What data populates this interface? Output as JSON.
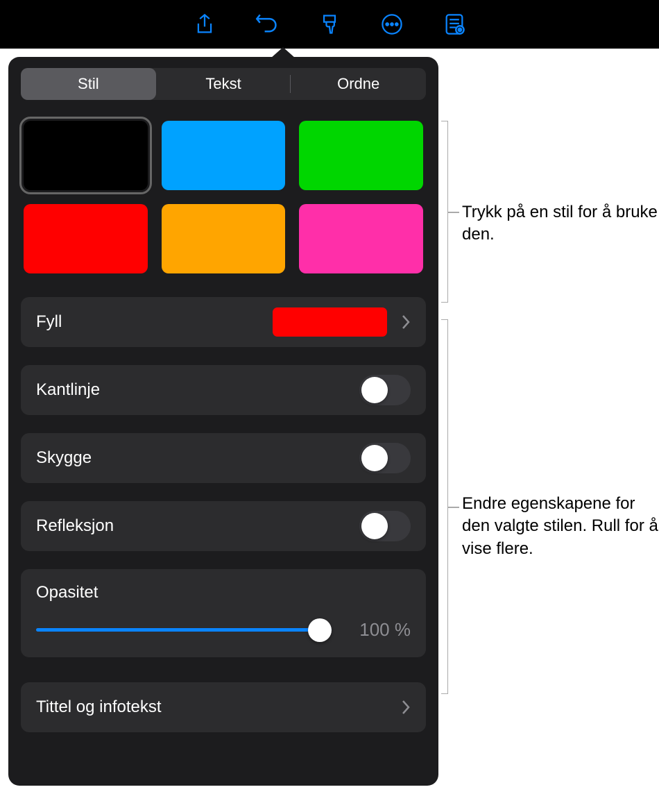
{
  "toolbar": {
    "icons": [
      "share-icon",
      "undo-icon",
      "format-brush-icon",
      "more-icon",
      "presenter-notes-icon"
    ]
  },
  "tabs": {
    "items": [
      {
        "label": "Stil",
        "selected": true
      },
      {
        "label": "Tekst",
        "selected": false
      },
      {
        "label": "Ordne",
        "selected": false
      }
    ]
  },
  "styles": {
    "swatches": [
      {
        "color": "#000000",
        "selected": true
      },
      {
        "color": "#00a2ff"
      },
      {
        "color": "#00d600"
      },
      {
        "color": "#ff0000"
      },
      {
        "color": "#ffa500"
      },
      {
        "color": "#ff2fa9"
      }
    ]
  },
  "properties": {
    "fill": {
      "label": "Fyll",
      "color": "#ff0000"
    },
    "border": {
      "label": "Kantlinje",
      "enabled": false
    },
    "shadow": {
      "label": "Skygge",
      "enabled": false
    },
    "reflection": {
      "label": "Refleksjon",
      "enabled": false
    },
    "opacity": {
      "label": "Opasitet",
      "value_text": "100 %",
      "percent": 100
    },
    "title_caption": {
      "label": "Tittel og infotekst"
    }
  },
  "callouts": {
    "styles": "Trykk på en stil for å bruke den.",
    "properties": "Endre egenskapene for den valgte stilen. Rull for å vise flere."
  }
}
